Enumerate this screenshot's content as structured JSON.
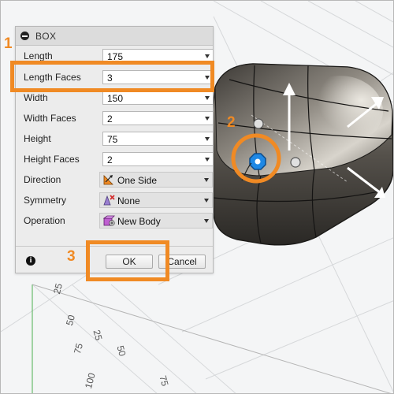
{
  "dialog": {
    "title": "BOX",
    "fields": [
      {
        "label": "Length",
        "value": "175"
      },
      {
        "label": "Length Faces",
        "value": "3"
      },
      {
        "label": "Width",
        "value": "150"
      },
      {
        "label": "Width Faces",
        "value": "2"
      },
      {
        "label": "Height",
        "value": "75"
      },
      {
        "label": "Height Faces",
        "value": "2"
      }
    ],
    "selects": [
      {
        "label": "Direction",
        "value": "One Side",
        "icon": "direction-one-side-icon"
      },
      {
        "label": "Symmetry",
        "value": "None",
        "icon": "symmetry-none-icon"
      },
      {
        "label": "Operation",
        "value": "New Body",
        "icon": "new-body-icon"
      }
    ],
    "ok_label": "OK",
    "cancel_label": "Cancel",
    "info_label": "i"
  },
  "callouts": {
    "one": "1",
    "two": "2",
    "three": "3",
    "color": "#f08a24"
  },
  "ruler": {
    "labels": [
      "25",
      "50",
      "75",
      "100",
      "25",
      "50",
      "75"
    ]
  },
  "colors": {
    "accent": "#f08a24",
    "manipulator": "#1e88e5"
  }
}
